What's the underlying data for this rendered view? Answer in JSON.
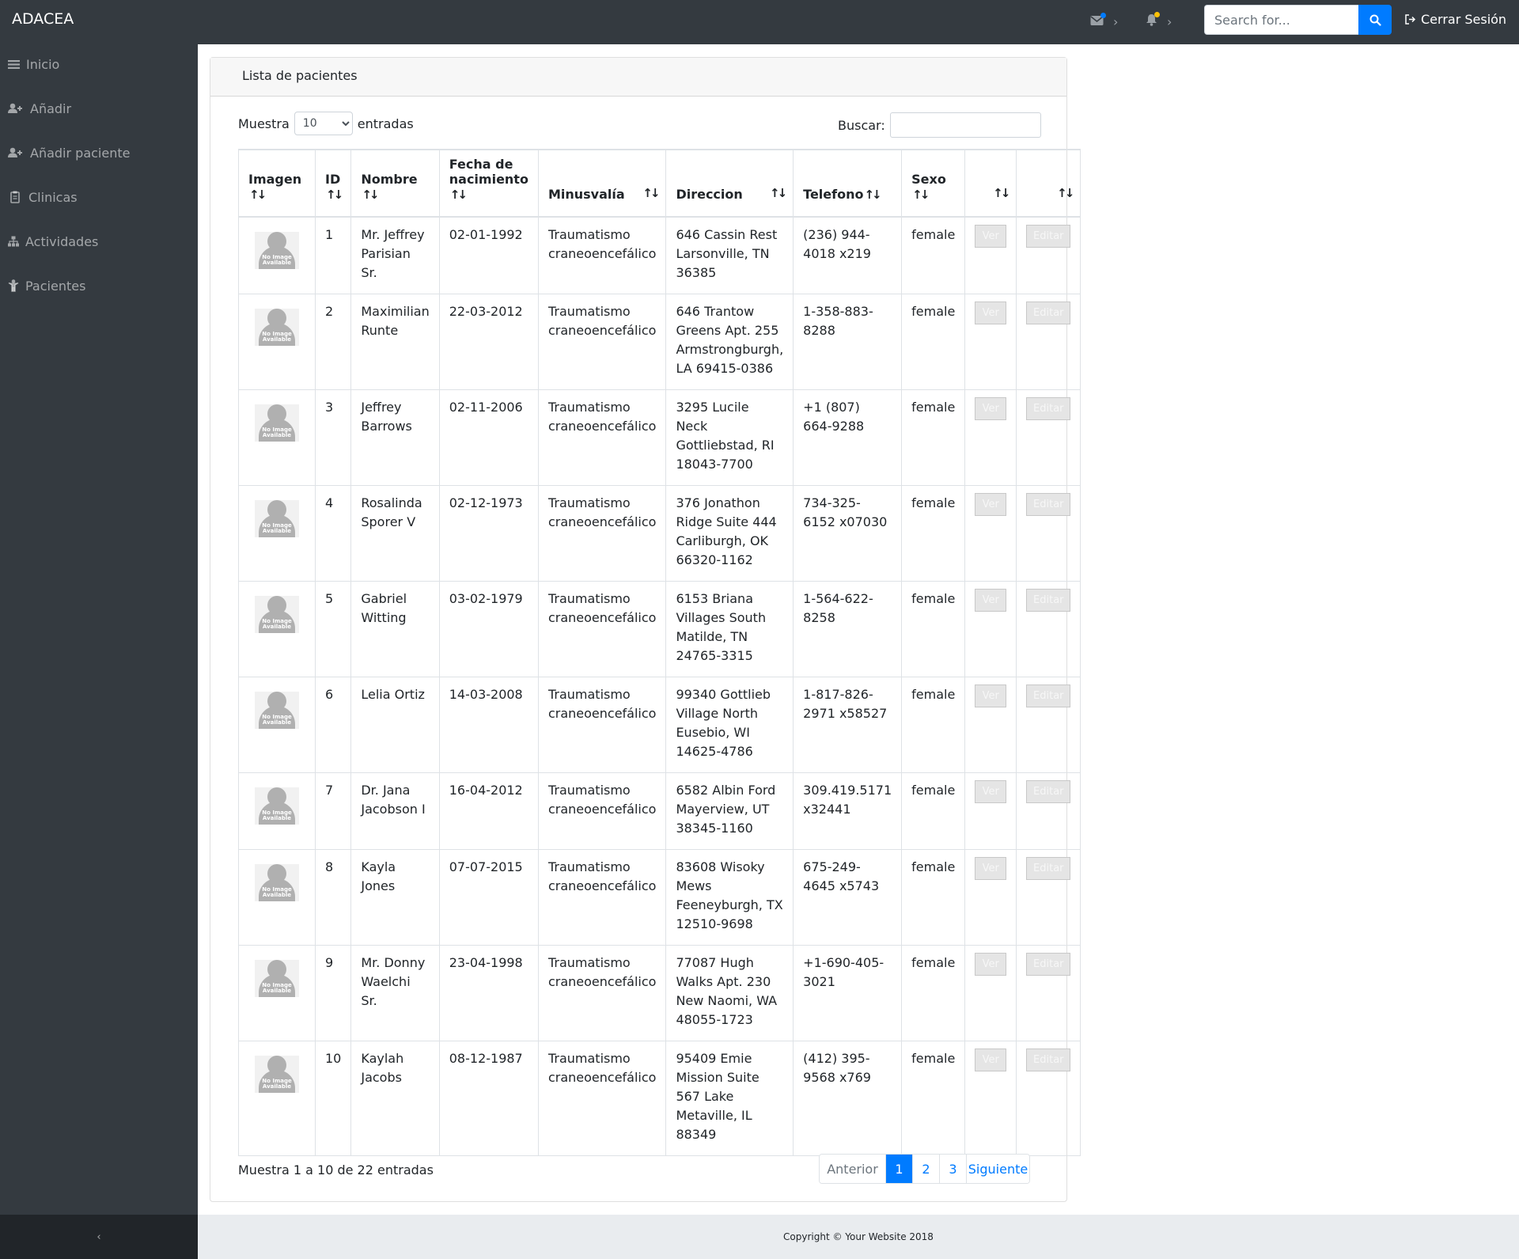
{
  "navbar": {
    "brand": "ADACEA",
    "search_placeholder": "Search for...",
    "logout_label": "Cerrar Sesión",
    "messages_badge_color": "#007bff",
    "alerts_badge_color": "#ffc107"
  },
  "sidebar": {
    "items": [
      {
        "label": "Inicio",
        "icon": "bars-icon"
      },
      {
        "label": "Añadir",
        "icon": "user-plus-icon"
      },
      {
        "label": "Añadir paciente",
        "icon": "user-plus-icon"
      },
      {
        "label": "Clinicas",
        "icon": "clipboard-icon"
      },
      {
        "label": "Actividades",
        "icon": "sitemap-icon"
      },
      {
        "label": "Pacientes",
        "icon": "child-icon"
      }
    ],
    "toggle": "‹"
  },
  "card": {
    "title": "Lista de pacientes",
    "length_prefix": "Muestra",
    "length_value": "10",
    "length_suffix": "entradas",
    "filter_label": "Buscar:",
    "info": "Muestra 1 a 10 de 22 entradas"
  },
  "table": {
    "headers": [
      "Imagen",
      "ID",
      "Nombre",
      "Fecha de nacimiento",
      "Minusvalía",
      "Direccion",
      "Telefono",
      "Sexo",
      "",
      ""
    ],
    "image_label": "No Image Available",
    "view_label": "Ver",
    "edit_label": "Editar",
    "rows": [
      {
        "id": "1",
        "name": "Mr. Jeffrey Parisian Sr.",
        "dob": "02-01-1992",
        "disability": "Traumatismo craneoencefálico",
        "address": "646 Cassin Rest Larsonville, TN 36385",
        "phone": "(236) 944-4018 x219",
        "sex": "female"
      },
      {
        "id": "2",
        "name": "Maximilian Runte",
        "dob": "22-03-2012",
        "disability": "Traumatismo craneoencefálico",
        "address": "646 Trantow Greens Apt. 255 Armstrongburgh, LA 69415-0386",
        "phone": "1-358-883-8288",
        "sex": "female"
      },
      {
        "id": "3",
        "name": "Jeffrey Barrows",
        "dob": "02-11-2006",
        "disability": "Traumatismo craneoencefálico",
        "address": "3295 Lucile Neck Gottliebstad, RI 18043-7700",
        "phone": "+1 (807) 664-9288",
        "sex": "female"
      },
      {
        "id": "4",
        "name": "Rosalinda Sporer V",
        "dob": "02-12-1973",
        "disability": "Traumatismo craneoencefálico",
        "address": "376 Jonathon Ridge Suite 444 Carliburgh, OK 66320-1162",
        "phone": "734-325-6152 x07030",
        "sex": "female"
      },
      {
        "id": "5",
        "name": "Gabriel Witting",
        "dob": "03-02-1979",
        "disability": "Traumatismo craneoencefálico",
        "address": "6153 Briana Villages South Matilde, TN 24765-3315",
        "phone": "1-564-622-8258",
        "sex": "female"
      },
      {
        "id": "6",
        "name": "Lelia Ortiz",
        "dob": "14-03-2008",
        "disability": "Traumatismo craneoencefálico",
        "address": "99340 Gottlieb Village North Eusebio, WI 14625-4786",
        "phone": "1-817-826-2971 x58527",
        "sex": "female"
      },
      {
        "id": "7",
        "name": "Dr. Jana Jacobson I",
        "dob": "16-04-2012",
        "disability": "Traumatismo craneoencefálico",
        "address": "6582 Albin Ford Mayerview, UT 38345-1160",
        "phone": "309.419.5171 x32441",
        "sex": "female"
      },
      {
        "id": "8",
        "name": "Kayla Jones",
        "dob": "07-07-2015",
        "disability": "Traumatismo craneoencefálico",
        "address": "83608 Wisoky Mews Feeneyburgh, TX 12510-9698",
        "phone": "675-249-4645 x5743",
        "sex": "female"
      },
      {
        "id": "9",
        "name": "Mr. Donny Waelchi Sr.",
        "dob": "23-04-1998",
        "disability": "Traumatismo craneoencefálico",
        "address": "77087 Hugh Walks Apt. 230 New Naomi, WA 48055-1723",
        "phone": "+1-690-405-3021",
        "sex": "female"
      },
      {
        "id": "10",
        "name": "Kaylah Jacobs",
        "dob": "08-12-1987",
        "disability": "Traumatismo craneoencefálico",
        "address": "95409 Emie Mission Suite 567 Lake Metaville, IL 88349",
        "phone": "(412) 395-9568 x769",
        "sex": "female"
      }
    ]
  },
  "pagination": {
    "previous": "Anterior",
    "pages": [
      "1",
      "2",
      "3"
    ],
    "active_page": "1",
    "next": "Siguiente"
  },
  "footer": {
    "copyright": "Copyright © Your Website 2018"
  }
}
